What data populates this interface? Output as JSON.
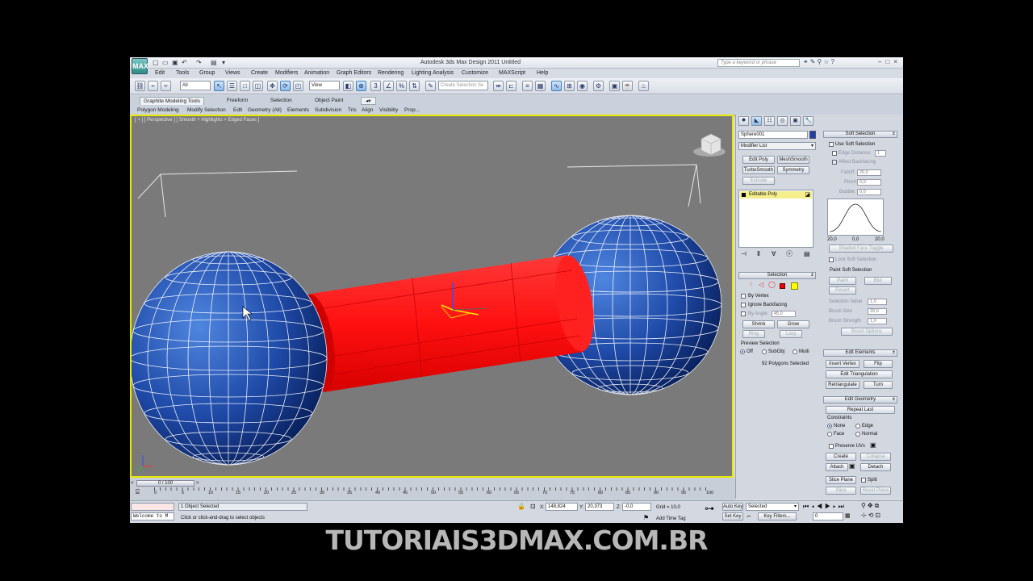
{
  "app": {
    "logo_text": "MAX",
    "title": "Autodesk 3ds Max Design 2011     Untitled",
    "search_placeholder": "Type a keyword or phrase"
  },
  "menu": [
    "Edit",
    "Tools",
    "Group",
    "Views",
    "Create",
    "Modifiers",
    "Animation",
    "Graph Editors",
    "Rendering",
    "Lighting Analysis",
    "Customize",
    "MAXScript",
    "Help"
  ],
  "toolbar": {
    "filter_select": "All",
    "view_select": "View",
    "selection_set_placeholder": "Create Selection Se"
  },
  "ribbon": {
    "tabs": [
      "Graphite Modeling Tools",
      "Freeform",
      "Selection",
      "Object Paint"
    ],
    "subtabs": [
      "Polygon Modeling",
      "Modify Selection",
      "Edit",
      "Geometry (All)",
      "Elements",
      "Subdivision",
      "Tris",
      "Align",
      "Visibility",
      "Prop..."
    ]
  },
  "viewport": {
    "label": "[ + ] [ Perspective ] [ Smooth + Highlights + Edged Faces ]"
  },
  "modify_panel": {
    "object_name": "Sphere001",
    "object_color": "#1c3fa8",
    "modifier_list": "Modifier List",
    "buttons": [
      "Edit Poly",
      "MeshSmooth",
      "TurboSmooth",
      "Symmetry",
      "Extrude"
    ],
    "stack_item": "Editable Poly",
    "selection": {
      "title": "Selection",
      "by_vertex": "By Vertex",
      "ignore_backfacing": "Ignore Backfacing",
      "by_angle": "By Angle:",
      "angle_value": "45,0",
      "shrink": "Shrink",
      "grow": "Grow",
      "ring": "Ring",
      "loop": "Loop",
      "preview_selection": "Preview Selection",
      "off": "Off",
      "subobj": "SubObj",
      "multi": "Multi",
      "status": "92 Polygons Selected"
    }
  },
  "soft_selection": {
    "title": "Soft Selection",
    "use_soft_selection": "Use Soft Selection",
    "edge_distance": "Edge Distance:",
    "edge_distance_value": "1",
    "affect_backfacing": "Affect Backfacing",
    "falloff": "Falloff:",
    "falloff_value": "20,0",
    "pinch": "Pinch:",
    "pinch_value": "0,0",
    "bubble": "Bubble:",
    "bubble_value": "0,0",
    "curve_labels": [
      "20,0",
      "0,0",
      "20,0"
    ],
    "shaded_face_toggle": "Shaded Face Toggle",
    "lock_soft_selection": "Lock Soft Selection",
    "paint_soft_selection": "Paint Soft Selection",
    "paint": "Paint",
    "blur": "Blur",
    "revert": "Revert",
    "selection_value": "Selection Value",
    "selection_value_v": "1,0",
    "brush_size": "Brush Size",
    "brush_size_v": "20,0",
    "brush_strength": "Brush Strength",
    "brush_strength_v": "1,0",
    "brush_options": "Brush Options"
  },
  "edit_elements": {
    "title": "Edit Elements",
    "insert_vertex": "Insert Vertex",
    "flip": "Flip",
    "edit_triangulation": "Edit Triangulation",
    "retriangulate": "Retriangulate",
    "turn": "Turn"
  },
  "edit_geometry": {
    "title": "Edit Geometry",
    "repeat_last": "Repeat Last",
    "constraints": "Constraints",
    "none": "None",
    "edge": "Edge",
    "face": "Face",
    "normal": "Normal",
    "preserve_uvs": "Preserve UVs",
    "create": "Create",
    "collapse": "Collapse",
    "attach": "Attach",
    "detach": "Detach",
    "slice_plane": "Slice Plane",
    "split": "Split",
    "slice": "Slice",
    "reset_plane": "Reset Plane"
  },
  "timeline": {
    "frame": "0 / 100",
    "ticks": [
      "0",
      "5",
      "10",
      "15",
      "20",
      "25",
      "30",
      "35",
      "40",
      "45",
      "50",
      "55",
      "60",
      "65",
      "70",
      "75",
      "80",
      "85",
      "90",
      "95",
      "100"
    ]
  },
  "status": {
    "welcome": "Welcome to M",
    "selected": "1 Object Selected",
    "prompt": "Click or click-and-drag to select objects",
    "x_label": "X:",
    "x": "148,824",
    "y_label": "Y:",
    "y": "20,373",
    "z_label": "Z:",
    "z": "-0,0",
    "grid": "Grid = 10,0",
    "add_time_tag": "Add Time Tag",
    "auto_key": "Auto Key",
    "set_key": "Set Key",
    "selected_dropdown": "Selected",
    "key_filters": "Key Filters...",
    "current_frame": "0"
  },
  "watermark": "TUTORIAIS3DMAX.COM.BR",
  "colors": {
    "sphere": "#1f4aa8",
    "cylinder": "#ff1010",
    "viewport_bg": "#7a7a7a",
    "active_border": "#e8e800"
  }
}
